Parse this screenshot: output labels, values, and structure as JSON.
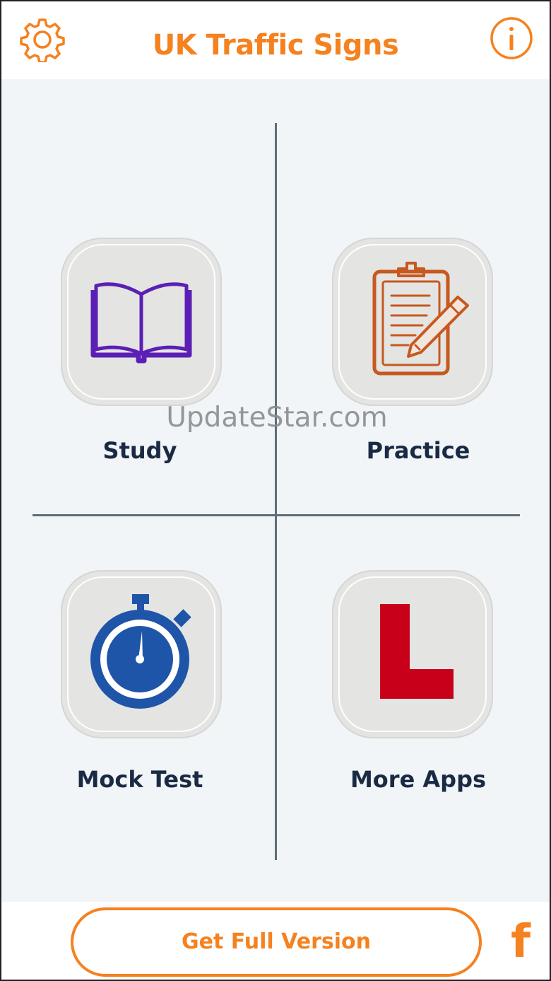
{
  "header": {
    "title": "UK Traffic Signs",
    "settings_icon": "gear-icon",
    "info_icon": "info-icon"
  },
  "menu": {
    "items": [
      {
        "label": "Study",
        "icon": "book-icon",
        "icon_color": "#5b1fb5"
      },
      {
        "label": "Practice",
        "icon": "clipboard-pen-icon",
        "icon_color": "#c7581f"
      },
      {
        "label": "Mock Test",
        "icon": "stopwatch-icon",
        "icon_color": "#1e55a8"
      },
      {
        "label": "More Apps",
        "icon": "learner-l-icon",
        "icon_color": "#c9001a"
      }
    ]
  },
  "watermark": "UpdateStar.com",
  "footer": {
    "full_version_label": "Get Full Version",
    "facebook_label": "f"
  },
  "colors": {
    "accent": "#f5811f",
    "label": "#1a2a44",
    "divider": "#5e6d78",
    "content_bg": "#f1f5f8"
  }
}
